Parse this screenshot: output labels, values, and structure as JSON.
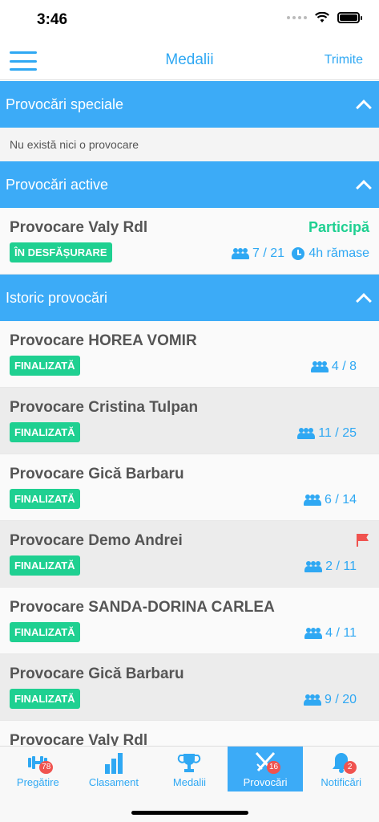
{
  "status": {
    "time": "3:46"
  },
  "nav": {
    "title": "Medalii",
    "action": "Trimite"
  },
  "sections": {
    "special": {
      "title": "Provocări speciale",
      "empty": "Nu există nici o provocare"
    },
    "active": {
      "title": "Provocări active"
    },
    "history": {
      "title": "Istoric provocări"
    }
  },
  "active_rows": [
    {
      "title": "Provocare Valy Rdl",
      "badge": "ÎN DESFĂȘURARE",
      "participants": "7 / 21",
      "action": "Participă",
      "time_left": "4h rămase"
    }
  ],
  "history_rows": [
    {
      "title": "Provocare HOREA VOMIR",
      "badge": "FINALIZATĂ",
      "participants": "4 / 8"
    },
    {
      "title": "Provocare Cristina Tulpan",
      "badge": "FINALIZATĂ",
      "participants": "11 / 25"
    },
    {
      "title": "Provocare Gică Barbaru",
      "badge": "FINALIZATĂ",
      "participants": "6 / 14"
    },
    {
      "title": "Provocare Demo Andrei",
      "badge": "FINALIZATĂ",
      "participants": "2 / 11",
      "flag": "flag-icon"
    },
    {
      "title": "Provocare SANDA-DORINA CARLEA",
      "badge": "FINALIZATĂ",
      "participants": "4 / 11"
    },
    {
      "title": "Provocare Gică Barbaru",
      "badge": "FINALIZATĂ",
      "participants": "9 / 20"
    },
    {
      "title": "Provocare Valy Rdl"
    }
  ],
  "tabs": [
    {
      "label": "Pregătire",
      "icon": "dumbbell-icon",
      "badge": "78"
    },
    {
      "label": "Clasament",
      "icon": "bar-chart-icon"
    },
    {
      "label": "Medalii",
      "icon": "trophy-icon"
    },
    {
      "label": "Provocări",
      "icon": "crossed-swords-icon",
      "badge": "16",
      "active": true
    },
    {
      "label": "Notificări",
      "icon": "bell-icon",
      "badge": "2"
    }
  ],
  "colors": {
    "accent": "#3cabf7",
    "success": "#1fd091",
    "alert": "#f0534f"
  }
}
